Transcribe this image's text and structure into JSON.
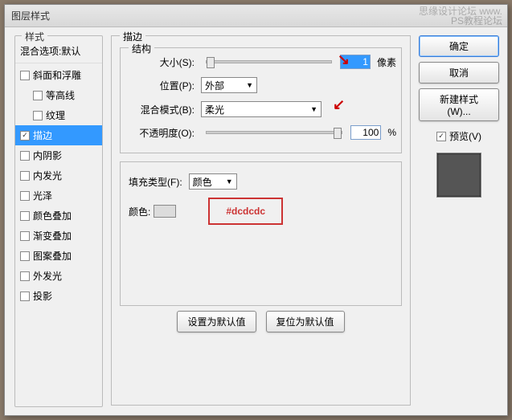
{
  "window": {
    "title": "图层样式"
  },
  "watermark": {
    "line1": "思缘设计论坛  www.",
    "line2": "PS教程论坛"
  },
  "styles": {
    "legend": "样式",
    "blending": "混合选项:默认",
    "items": [
      {
        "label": "斜面和浮雕",
        "checked": false
      },
      {
        "label": "等高线",
        "checked": false
      },
      {
        "label": "纹理",
        "checked": false
      },
      {
        "label": "描边",
        "checked": true,
        "selected": true
      },
      {
        "label": "内阴影",
        "checked": false
      },
      {
        "label": "内发光",
        "checked": false
      },
      {
        "label": "光泽",
        "checked": false
      },
      {
        "label": "颜色叠加",
        "checked": false
      },
      {
        "label": "渐变叠加",
        "checked": false
      },
      {
        "label": "图案叠加",
        "checked": false
      },
      {
        "label": "外发光",
        "checked": false
      },
      {
        "label": "投影",
        "checked": false
      }
    ]
  },
  "stroke": {
    "legend": "描边",
    "structure_legend": "结构",
    "size_label": "大小(S):",
    "size_value": "1",
    "size_unit": "像素",
    "position_label": "位置(P):",
    "position_value": "外部",
    "blend_label": "混合模式(B):",
    "blend_value": "柔光",
    "opacity_label": "不透明度(O):",
    "opacity_value": "100",
    "opacity_unit": "%",
    "fill_legend": "填充类型(F):",
    "fill_value": "颜色",
    "color_label": "颜色:",
    "hex": "#dcdcdc",
    "default_btn": "设置为默认值",
    "reset_btn": "复位为默认值"
  },
  "buttons": {
    "ok": "确定",
    "cancel": "取消",
    "newstyle": "新建样式(W)...",
    "preview": "预览(V)"
  }
}
